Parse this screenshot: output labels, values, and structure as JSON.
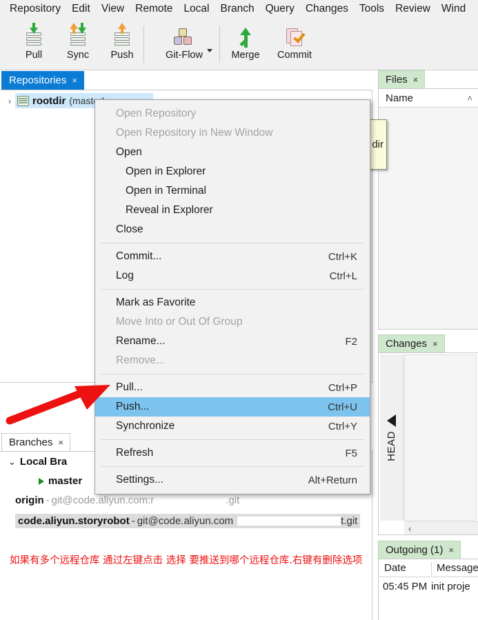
{
  "menubar": {
    "items": [
      "Repository",
      "Edit",
      "View",
      "Remote",
      "Local",
      "Branch",
      "Query",
      "Changes",
      "Tools",
      "Review",
      "Wind"
    ]
  },
  "toolbar": {
    "buttons": [
      {
        "label": "Pull",
        "icon": "pull-icon"
      },
      {
        "label": "Sync",
        "icon": "sync-icon"
      },
      {
        "label": "Push",
        "icon": "push-icon"
      },
      {
        "label": "Git-Flow",
        "icon": "gitflow-icon"
      },
      {
        "label": "Merge",
        "icon": "merge-icon"
      },
      {
        "label": "Commit",
        "icon": "commit-icon"
      }
    ]
  },
  "repositories": {
    "tab_label": "Repositories",
    "close": "×",
    "expand_chevron": "›",
    "item_name": "rootdir",
    "item_branch": "(master)"
  },
  "files": {
    "tab_label": "Files",
    "close": "×",
    "column_name": "Name",
    "sort_caret": "˄"
  },
  "tooltip": {
    "text": "dir"
  },
  "changes": {
    "tab_label": "Changes",
    "close": "×",
    "head_label": "HEAD",
    "scroll_left": "‹"
  },
  "outgoing": {
    "tab_label": "Outgoing (1)",
    "close": "×",
    "col_date": "Date",
    "col_message": "Message",
    "row_date": "05:45 PM",
    "row_message": "init proje"
  },
  "branches": {
    "tab_label": "Branches",
    "close": "×",
    "group_chevron": "⌄",
    "group_label": "Local Bra",
    "local_branch": "master",
    "remotes": [
      {
        "name": "origin",
        "sep": " - ",
        "url_prefix": "git@code.aliyun.com:r",
        "url_suffix": ".git",
        "selected": false
      },
      {
        "name": "code.aliyun.storyrobot",
        "sep": " - ",
        "url_prefix": "git@code.aliyun.com",
        "url_suffix": "t.git",
        "selected": true
      }
    ]
  },
  "annotation": {
    "note_cn": "如果有多个远程仓库 通过左键点击 选择 要推送到哪个远程仓库.右键有删除选项",
    "arrow_color": "#ee1111"
  },
  "context_menu": {
    "items": [
      {
        "label": "Open Repository",
        "accel": "",
        "disabled": true,
        "indent": false,
        "selected": false
      },
      {
        "label": "Open Repository in New Window",
        "accel": "",
        "disabled": true,
        "indent": false,
        "selected": false
      },
      {
        "label": "Open",
        "accel": "",
        "disabled": false,
        "indent": false,
        "selected": false
      },
      {
        "label": "Open in Explorer",
        "accel": "",
        "disabled": false,
        "indent": true,
        "selected": false
      },
      {
        "label": "Open in Terminal",
        "accel": "",
        "disabled": false,
        "indent": true,
        "selected": false
      },
      {
        "label": "Reveal in Explorer",
        "accel": "",
        "disabled": false,
        "indent": true,
        "selected": false
      },
      {
        "label": "Close",
        "accel": "",
        "disabled": false,
        "indent": false,
        "selected": false
      },
      {
        "separator": true
      },
      {
        "label": "Commit...",
        "accel": "Ctrl+K",
        "disabled": false,
        "indent": false,
        "selected": false
      },
      {
        "label": "Log",
        "accel": "Ctrl+L",
        "disabled": false,
        "indent": false,
        "selected": false
      },
      {
        "separator": true
      },
      {
        "label": "Mark as Favorite",
        "accel": "",
        "disabled": false,
        "indent": false,
        "selected": false
      },
      {
        "label": "Move Into or Out Of Group",
        "accel": "",
        "disabled": true,
        "indent": false,
        "selected": false
      },
      {
        "label": "Rename...",
        "accel": "F2",
        "disabled": false,
        "indent": false,
        "selected": false
      },
      {
        "label": "Remove...",
        "accel": "",
        "disabled": true,
        "indent": false,
        "selected": false
      },
      {
        "separator": true
      },
      {
        "label": "Pull...",
        "accel": "Ctrl+P",
        "disabled": false,
        "indent": false,
        "selected": false
      },
      {
        "label": "Push...",
        "accel": "Ctrl+U",
        "disabled": false,
        "indent": false,
        "selected": true
      },
      {
        "label": "Synchronize",
        "accel": "Ctrl+Y",
        "disabled": false,
        "indent": false,
        "selected": false
      },
      {
        "separator": true
      },
      {
        "label": "Refresh",
        "accel": "F5",
        "disabled": false,
        "indent": false,
        "selected": false
      },
      {
        "separator": true
      },
      {
        "label": "Settings...",
        "accel": "Alt+Return",
        "disabled": false,
        "indent": false,
        "selected": false
      }
    ]
  },
  "colors": {
    "accent_tab": "#0b7bd4",
    "tab_green": "#cfe7cc",
    "menu_highlight": "#7cc4ee",
    "annotation_red": "#ee1111",
    "arrow_green": "#2faa3a",
    "arrow_orange": "#f0a032"
  }
}
